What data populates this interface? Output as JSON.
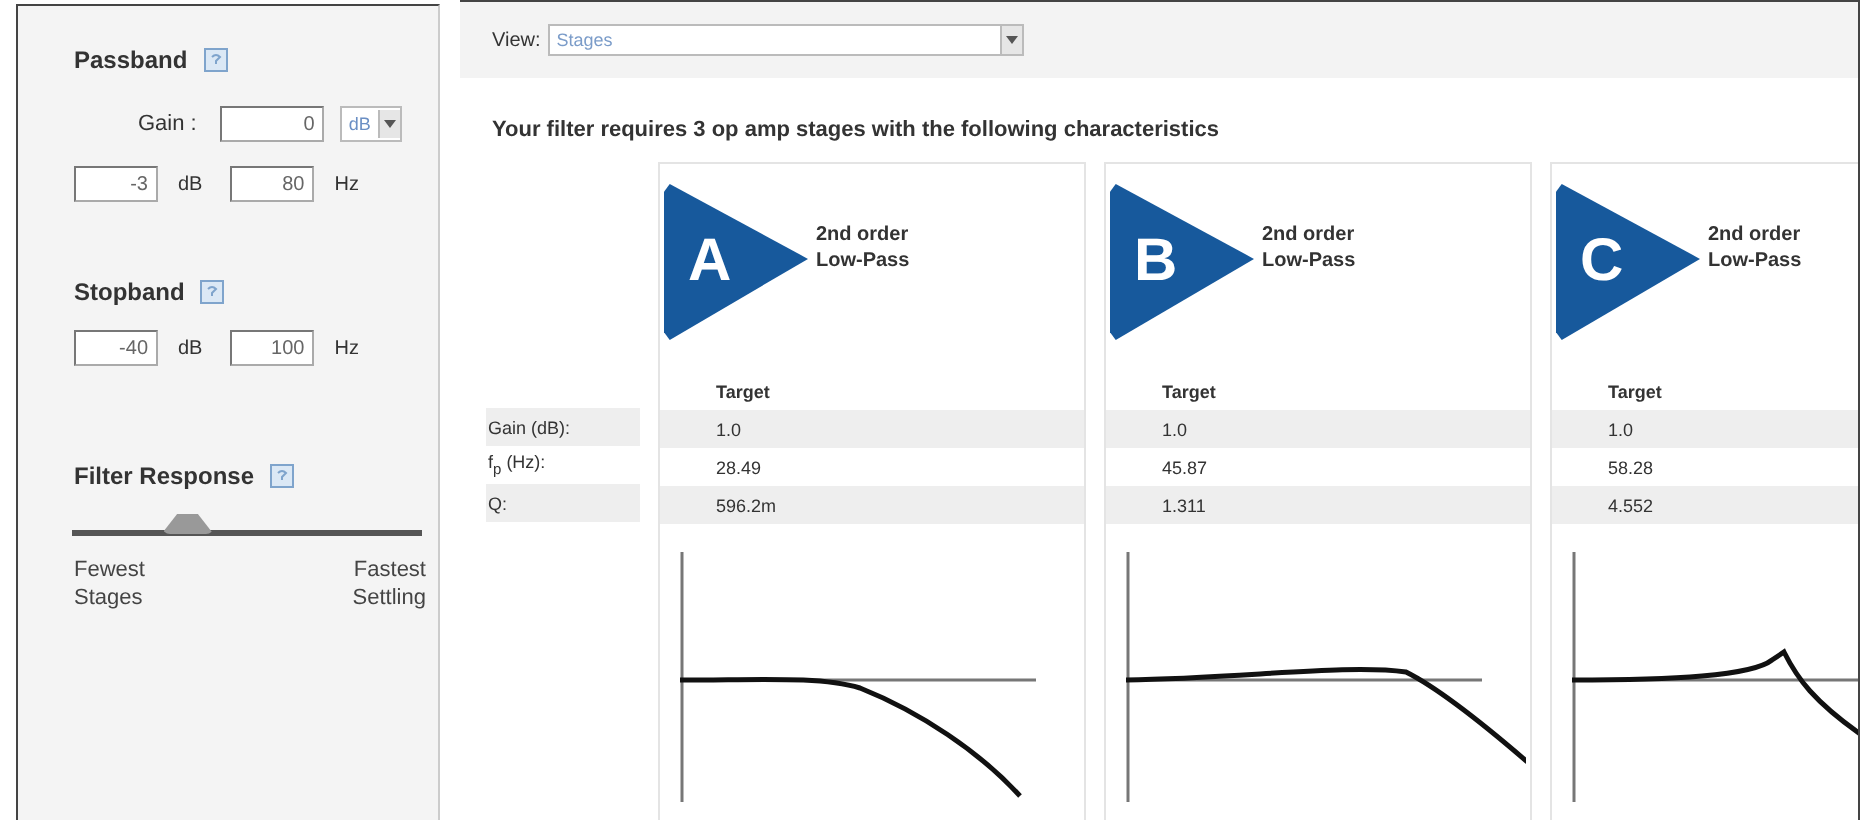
{
  "sidebar": {
    "passband": {
      "title": "Passband",
      "gain_label": "Gain :",
      "gain_value": "0",
      "gain_unit": "dB",
      "attenuation": "-3",
      "attenuation_unit": "dB",
      "frequency": "80",
      "frequency_unit": "Hz"
    },
    "stopband": {
      "title": "Stopband",
      "attenuation": "-40",
      "attenuation_unit": "dB",
      "frequency": "100",
      "frequency_unit": "Hz"
    },
    "filter_response": {
      "title": "Filter Response",
      "level": 0.33,
      "left_label": "Fewest Stages",
      "right_label": "Fastest Settling"
    }
  },
  "view": {
    "label": "View:",
    "value": "Stages"
  },
  "heading": "Your filter requires 3 op amp stages with the following characteristics",
  "row_labels": [
    "Gain (dB):",
    "f$_{p}$ (Hz):",
    "Q:"
  ],
  "stages": [
    {
      "letter": "A",
      "title": "2nd order Low-Pass",
      "column": "Target",
      "values": [
        "1.0",
        "28.49",
        "596.2m"
      ],
      "kind": "flat"
    },
    {
      "letter": "B",
      "title": "2nd order Low-Pass",
      "column": "Target",
      "values": [
        "1.0",
        "45.87",
        "1.311"
      ],
      "kind": "bump"
    },
    {
      "letter": "C",
      "title": "2nd order Low-Pass",
      "column": "Target",
      "values": [
        "1.0",
        "58.28",
        "4.552"
      ],
      "kind": "peak"
    }
  ]
}
